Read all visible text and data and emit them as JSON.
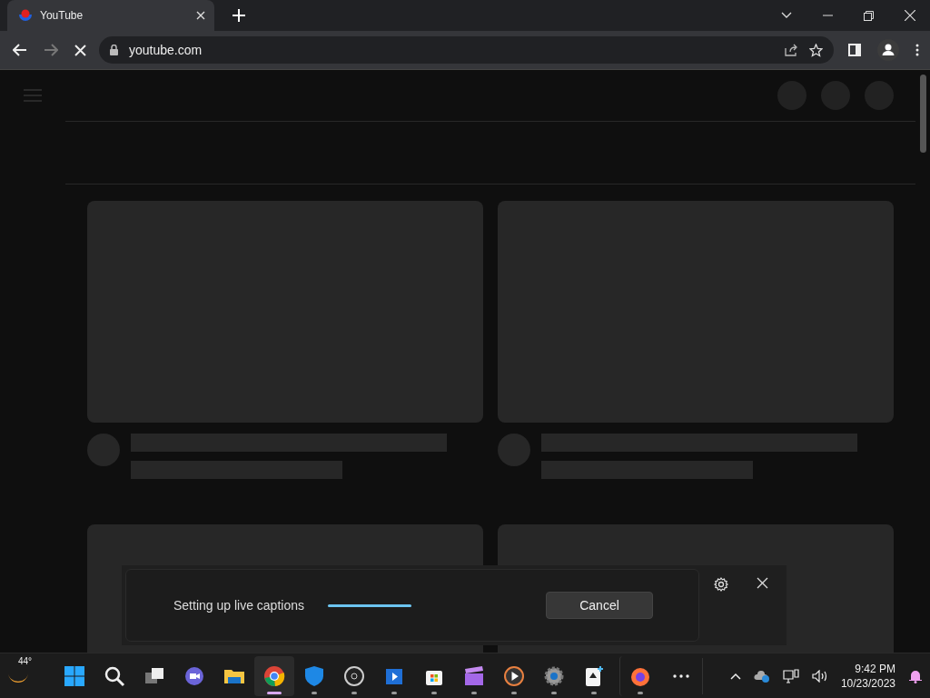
{
  "browser": {
    "tab": {
      "title": "YouTube"
    },
    "address": "youtube.com"
  },
  "captions_panel": {
    "message": "Setting up live captions",
    "level": 1,
    "button": "Cancel"
  },
  "taskbar": {
    "weather": "44°",
    "apps": [
      {
        "kind": "start",
        "running": false,
        "selected": false
      },
      {
        "kind": "search",
        "running": false,
        "selected": false
      },
      {
        "kind": "taskview",
        "running": false,
        "selected": false
      },
      {
        "kind": "chat",
        "running": false,
        "selected": false
      },
      {
        "kind": "folder",
        "running": false,
        "selected": false
      },
      {
        "kind": "browser",
        "running": true,
        "selected": true
      },
      {
        "kind": "shield",
        "running": true,
        "selected": false
      },
      {
        "kind": "recorder",
        "running": true,
        "selected": false
      },
      {
        "kind": "video",
        "running": true,
        "selected": false
      },
      {
        "kind": "store",
        "running": true,
        "selected": false
      },
      {
        "kind": "clapper",
        "running": true,
        "selected": false
      },
      {
        "kind": "player",
        "running": true,
        "selected": false
      },
      {
        "kind": "gear",
        "running": true,
        "selected": false
      },
      {
        "kind": "cards",
        "running": true,
        "selected": false
      },
      {
        "kind": "fox",
        "running": true,
        "selected": false
      }
    ],
    "clock": {
      "time": "9:42 PM",
      "date": "10/23/2023"
    }
  }
}
